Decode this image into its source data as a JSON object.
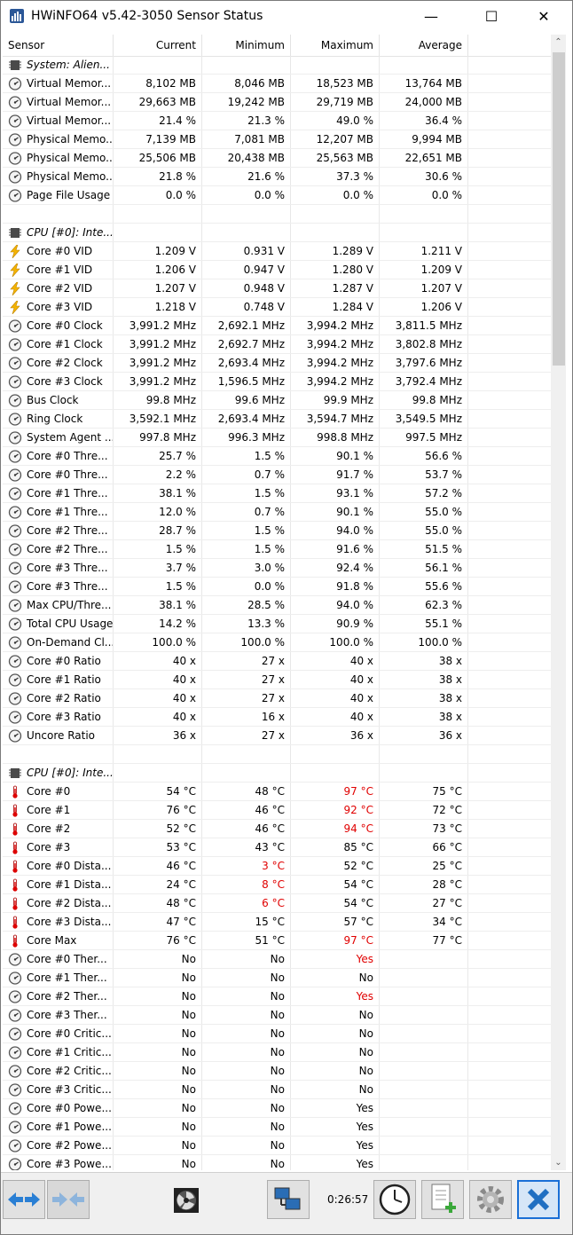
{
  "window": {
    "title": "HWiNFO64 v5.42-3050 Sensor Status",
    "minimize_glyph": "—",
    "maximize_glyph": "☐",
    "close_glyph": "✕"
  },
  "columns": {
    "sensor": "Sensor",
    "current": "Current",
    "minimum": "Minimum",
    "maximum": "Maximum",
    "average": "Average"
  },
  "colors": {
    "warning_red": "#e00000",
    "accent_blue": "#1a6fd6",
    "close_red": "#d02020"
  },
  "rows": [
    {
      "type": "group",
      "icon": "chip-icon",
      "name": "System: Alien...",
      "cur": "",
      "min": "",
      "max": "",
      "avg": ""
    },
    {
      "type": "sensor",
      "icon": "gauge-icon",
      "name": "Virtual Memor...",
      "cur": "8,102 MB",
      "min": "8,046 MB",
      "max": "18,523 MB",
      "avg": "13,764 MB"
    },
    {
      "type": "sensor",
      "icon": "gauge-icon",
      "name": "Virtual Memor...",
      "cur": "29,663 MB",
      "min": "19,242 MB",
      "max": "29,719 MB",
      "avg": "24,000 MB"
    },
    {
      "type": "sensor",
      "icon": "gauge-icon",
      "name": "Virtual Memor...",
      "cur": "21.4 %",
      "min": "21.3 %",
      "max": "49.0 %",
      "avg": "36.4 %"
    },
    {
      "type": "sensor",
      "icon": "gauge-icon",
      "name": "Physical Memo...",
      "cur": "7,139 MB",
      "min": "7,081 MB",
      "max": "12,207 MB",
      "avg": "9,994 MB"
    },
    {
      "type": "sensor",
      "icon": "gauge-icon",
      "name": "Physical Memo...",
      "cur": "25,506 MB",
      "min": "20,438 MB",
      "max": "25,563 MB",
      "avg": "22,651 MB"
    },
    {
      "type": "sensor",
      "icon": "gauge-icon",
      "name": "Physical Memo...",
      "cur": "21.8 %",
      "min": "21.6 %",
      "max": "37.3 %",
      "avg": "30.6 %"
    },
    {
      "type": "sensor",
      "icon": "gauge-icon",
      "name": "Page File Usage",
      "cur": "0.0 %",
      "min": "0.0 %",
      "max": "0.0 %",
      "avg": "0.0 %"
    },
    {
      "type": "blank",
      "icon": "",
      "name": "",
      "cur": "",
      "min": "",
      "max": "",
      "avg": ""
    },
    {
      "type": "group",
      "icon": "chip-icon",
      "name": "CPU [#0]: Inte...",
      "cur": "",
      "min": "",
      "max": "",
      "avg": ""
    },
    {
      "type": "sensor",
      "icon": "voltage-icon",
      "name": "Core #0 VID",
      "cur": "1.209 V",
      "min": "0.931 V",
      "max": "1.289 V",
      "avg": "1.211 V"
    },
    {
      "type": "sensor",
      "icon": "voltage-icon",
      "name": "Core #1 VID",
      "cur": "1.206 V",
      "min": "0.947 V",
      "max": "1.280 V",
      "avg": "1.209 V"
    },
    {
      "type": "sensor",
      "icon": "voltage-icon",
      "name": "Core #2 VID",
      "cur": "1.207 V",
      "min": "0.948 V",
      "max": "1.287 V",
      "avg": "1.207 V"
    },
    {
      "type": "sensor",
      "icon": "voltage-icon",
      "name": "Core #3 VID",
      "cur": "1.218 V",
      "min": "0.748 V",
      "max": "1.284 V",
      "avg": "1.206 V"
    },
    {
      "type": "sensor",
      "icon": "gauge-icon",
      "name": "Core #0 Clock",
      "cur": "3,991.2 MHz",
      "min": "2,692.1 MHz",
      "max": "3,994.2 MHz",
      "avg": "3,811.5 MHz"
    },
    {
      "type": "sensor",
      "icon": "gauge-icon",
      "name": "Core #1 Clock",
      "cur": "3,991.2 MHz",
      "min": "2,692.7 MHz",
      "max": "3,994.2 MHz",
      "avg": "3,802.8 MHz"
    },
    {
      "type": "sensor",
      "icon": "gauge-icon",
      "name": "Core #2 Clock",
      "cur": "3,991.2 MHz",
      "min": "2,693.4 MHz",
      "max": "3,994.2 MHz",
      "avg": "3,797.6 MHz"
    },
    {
      "type": "sensor",
      "icon": "gauge-icon",
      "name": "Core #3 Clock",
      "cur": "3,991.2 MHz",
      "min": "1,596.5 MHz",
      "max": "3,994.2 MHz",
      "avg": "3,792.4 MHz"
    },
    {
      "type": "sensor",
      "icon": "gauge-icon",
      "name": "Bus Clock",
      "cur": "99.8 MHz",
      "min": "99.6 MHz",
      "max": "99.9 MHz",
      "avg": "99.8 MHz"
    },
    {
      "type": "sensor",
      "icon": "gauge-icon",
      "name": "Ring Clock",
      "cur": "3,592.1 MHz",
      "min": "2,693.4 MHz",
      "max": "3,594.7 MHz",
      "avg": "3,549.5 MHz"
    },
    {
      "type": "sensor",
      "icon": "gauge-icon",
      "name": "System Agent ...",
      "cur": "997.8 MHz",
      "min": "996.3 MHz",
      "max": "998.8 MHz",
      "avg": "997.5 MHz"
    },
    {
      "type": "sensor",
      "icon": "gauge-icon",
      "name": "Core #0 Thre...",
      "cur": "25.7 %",
      "min": "1.5 %",
      "max": "90.1 %",
      "avg": "56.6 %"
    },
    {
      "type": "sensor",
      "icon": "gauge-icon",
      "name": "Core #0 Thre...",
      "cur": "2.2 %",
      "min": "0.7 %",
      "max": "91.7 %",
      "avg": "53.7 %"
    },
    {
      "type": "sensor",
      "icon": "gauge-icon",
      "name": "Core #1 Thre...",
      "cur": "38.1 %",
      "min": "1.5 %",
      "max": "93.1 %",
      "avg": "57.2 %"
    },
    {
      "type": "sensor",
      "icon": "gauge-icon",
      "name": "Core #1 Thre...",
      "cur": "12.0 %",
      "min": "0.7 %",
      "max": "90.1 %",
      "avg": "55.0 %"
    },
    {
      "type": "sensor",
      "icon": "gauge-icon",
      "name": "Core #2 Thre...",
      "cur": "28.7 %",
      "min": "1.5 %",
      "max": "94.0 %",
      "avg": "55.0 %"
    },
    {
      "type": "sensor",
      "icon": "gauge-icon",
      "name": "Core #2 Thre...",
      "cur": "1.5 %",
      "min": "1.5 %",
      "max": "91.6 %",
      "avg": "51.5 %"
    },
    {
      "type": "sensor",
      "icon": "gauge-icon",
      "name": "Core #3 Thre...",
      "cur": "3.7 %",
      "min": "3.0 %",
      "max": "92.4 %",
      "avg": "56.1 %"
    },
    {
      "type": "sensor",
      "icon": "gauge-icon",
      "name": "Core #3 Thre...",
      "cur": "1.5 %",
      "min": "0.0 %",
      "max": "91.8 %",
      "avg": "55.6 %"
    },
    {
      "type": "sensor",
      "icon": "gauge-icon",
      "name": "Max CPU/Thre...",
      "cur": "38.1 %",
      "min": "28.5 %",
      "max": "94.0 %",
      "avg": "62.3 %"
    },
    {
      "type": "sensor",
      "icon": "gauge-icon",
      "name": "Total CPU Usage",
      "cur": "14.2 %",
      "min": "13.3 %",
      "max": "90.9 %",
      "avg": "55.1 %"
    },
    {
      "type": "sensor",
      "icon": "gauge-icon",
      "name": "On-Demand Cl...",
      "cur": "100.0 %",
      "min": "100.0 %",
      "max": "100.0 %",
      "avg": "100.0 %"
    },
    {
      "type": "sensor",
      "icon": "gauge-icon",
      "name": "Core #0 Ratio",
      "cur": "40 x",
      "min": "27 x",
      "max": "40 x",
      "avg": "38 x"
    },
    {
      "type": "sensor",
      "icon": "gauge-icon",
      "name": "Core #1 Ratio",
      "cur": "40 x",
      "min": "27 x",
      "max": "40 x",
      "avg": "38 x"
    },
    {
      "type": "sensor",
      "icon": "gauge-icon",
      "name": "Core #2 Ratio",
      "cur": "40 x",
      "min": "27 x",
      "max": "40 x",
      "avg": "38 x"
    },
    {
      "type": "sensor",
      "icon": "gauge-icon",
      "name": "Core #3 Ratio",
      "cur": "40 x",
      "min": "16 x",
      "max": "40 x",
      "avg": "38 x"
    },
    {
      "type": "sensor",
      "icon": "gauge-icon",
      "name": "Uncore Ratio",
      "cur": "36 x",
      "min": "27 x",
      "max": "36 x",
      "avg": "36 x"
    },
    {
      "type": "blank",
      "icon": "",
      "name": "",
      "cur": "",
      "min": "",
      "max": "",
      "avg": ""
    },
    {
      "type": "group",
      "icon": "chip-icon",
      "name": "CPU [#0]: Inte...",
      "cur": "",
      "min": "",
      "max": "",
      "avg": ""
    },
    {
      "type": "sensor",
      "icon": "thermometer-icon",
      "name": "Core #0",
      "cur": "54 °C",
      "min": "48 °C",
      "max": "97 °C",
      "avg": "75 °C",
      "red": [
        "max"
      ]
    },
    {
      "type": "sensor",
      "icon": "thermometer-icon",
      "name": "Core #1",
      "cur": "76 °C",
      "min": "46 °C",
      "max": "92 °C",
      "avg": "72 °C",
      "red": [
        "max"
      ]
    },
    {
      "type": "sensor",
      "icon": "thermometer-icon",
      "name": "Core #2",
      "cur": "52 °C",
      "min": "46 °C",
      "max": "94 °C",
      "avg": "73 °C",
      "red": [
        "max"
      ]
    },
    {
      "type": "sensor",
      "icon": "thermometer-icon",
      "name": "Core #3",
      "cur": "53 °C",
      "min": "43 °C",
      "max": "85 °C",
      "avg": "66 °C"
    },
    {
      "type": "sensor",
      "icon": "thermometer-icon",
      "name": "Core #0 Dista...",
      "cur": "46 °C",
      "min": "3 °C",
      "max": "52 °C",
      "avg": "25 °C",
      "red": [
        "min"
      ]
    },
    {
      "type": "sensor",
      "icon": "thermometer-icon",
      "name": "Core #1 Dista...",
      "cur": "24 °C",
      "min": "8 °C",
      "max": "54 °C",
      "avg": "28 °C",
      "red": [
        "min"
      ]
    },
    {
      "type": "sensor",
      "icon": "thermometer-icon",
      "name": "Core #2 Dista...",
      "cur": "48 °C",
      "min": "6 °C",
      "max": "54 °C",
      "avg": "27 °C",
      "red": [
        "min"
      ]
    },
    {
      "type": "sensor",
      "icon": "thermometer-icon",
      "name": "Core #3 Dista...",
      "cur": "47 °C",
      "min": "15 °C",
      "max": "57 °C",
      "avg": "34 °C"
    },
    {
      "type": "sensor",
      "icon": "thermometer-icon",
      "name": "Core Max",
      "cur": "76 °C",
      "min": "51 °C",
      "max": "97 °C",
      "avg": "77 °C",
      "red": [
        "max"
      ]
    },
    {
      "type": "sensor",
      "icon": "gauge-icon",
      "name": "Core #0 Ther...",
      "cur": "No",
      "min": "No",
      "max": "Yes",
      "avg": "",
      "red": [
        "max"
      ]
    },
    {
      "type": "sensor",
      "icon": "gauge-icon",
      "name": "Core #1 Ther...",
      "cur": "No",
      "min": "No",
      "max": "No",
      "avg": ""
    },
    {
      "type": "sensor",
      "icon": "gauge-icon",
      "name": "Core #2 Ther...",
      "cur": "No",
      "min": "No",
      "max": "Yes",
      "avg": "",
      "red": [
        "max"
      ]
    },
    {
      "type": "sensor",
      "icon": "gauge-icon",
      "name": "Core #3 Ther...",
      "cur": "No",
      "min": "No",
      "max": "No",
      "avg": ""
    },
    {
      "type": "sensor",
      "icon": "gauge-icon",
      "name": "Core #0 Critic...",
      "cur": "No",
      "min": "No",
      "max": "No",
      "avg": ""
    },
    {
      "type": "sensor",
      "icon": "gauge-icon",
      "name": "Core #1 Critic...",
      "cur": "No",
      "min": "No",
      "max": "No",
      "avg": ""
    },
    {
      "type": "sensor",
      "icon": "gauge-icon",
      "name": "Core #2 Critic...",
      "cur": "No",
      "min": "No",
      "max": "No",
      "avg": ""
    },
    {
      "type": "sensor",
      "icon": "gauge-icon",
      "name": "Core #3 Critic...",
      "cur": "No",
      "min": "No",
      "max": "No",
      "avg": ""
    },
    {
      "type": "sensor",
      "icon": "gauge-icon",
      "name": "Core #0 Powe...",
      "cur": "No",
      "min": "No",
      "max": "Yes",
      "avg": ""
    },
    {
      "type": "sensor",
      "icon": "gauge-icon",
      "name": "Core #1 Powe...",
      "cur": "No",
      "min": "No",
      "max": "Yes",
      "avg": ""
    },
    {
      "type": "sensor",
      "icon": "gauge-icon",
      "name": "Core #2 Powe...",
      "cur": "No",
      "min": "No",
      "max": "Yes",
      "avg": ""
    },
    {
      "type": "sensor",
      "icon": "gauge-icon",
      "name": "Core #3 Powe...",
      "cur": "No",
      "min": "No",
      "max": "Yes",
      "avg": ""
    }
  ],
  "scrollbar": {
    "up_glyph": "⌃",
    "down_glyph": "⌄"
  },
  "toolbar": {
    "elapsed_time": "0:26:57",
    "buttons": [
      "nav-arrows-icon",
      "collapse-arrows-icon",
      "fan-icon",
      "network-icon",
      "clock-icon",
      "add-report-icon",
      "settings-gear-icon",
      "close-x-icon"
    ]
  }
}
